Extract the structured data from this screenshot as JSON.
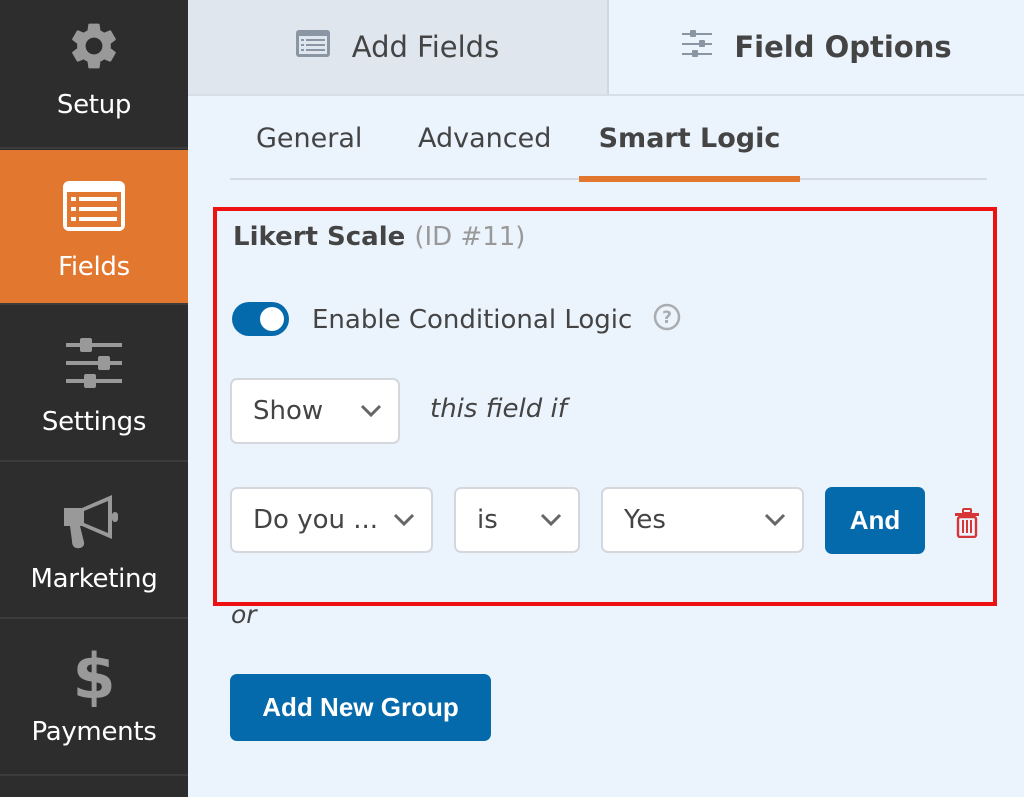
{
  "sidebar": {
    "items": [
      {
        "label": "Setup",
        "icon": "gear-icon",
        "active": false
      },
      {
        "label": "Fields",
        "icon": "form-list-icon",
        "active": true
      },
      {
        "label": "Settings",
        "icon": "sliders-icon",
        "active": false
      },
      {
        "label": "Marketing",
        "icon": "megaphone-icon",
        "active": false
      },
      {
        "label": "Payments",
        "icon": "dollar-icon",
        "active": false
      }
    ]
  },
  "top_tabs": {
    "add_fields": {
      "label": "Add Fields",
      "icon": "form-list-icon"
    },
    "field_options": {
      "label": "Field Options",
      "icon": "sliders-icon",
      "active": true
    }
  },
  "sub_tabs": [
    {
      "label": "General"
    },
    {
      "label": "Advanced"
    },
    {
      "label": "Smart Logic",
      "active": true
    }
  ],
  "field": {
    "name": "Likert Scale",
    "id_label": "(ID #11)"
  },
  "conditional_logic": {
    "toggle_label": "Enable Conditional Logic",
    "enabled": true,
    "help_icon": "question-circle-icon",
    "action_select": "Show",
    "action_suffix": "this field if",
    "rule": {
      "field_select": "Do you ...",
      "operator_select": "is",
      "value_select": "Yes",
      "and_button": "And",
      "delete_icon": "trash-icon"
    },
    "or_label": "or",
    "add_group_button": "Add New Group"
  },
  "colors": {
    "accent_orange": "#e27730",
    "primary_blue": "#056aab",
    "highlight_red": "#ee1111",
    "sidebar_bg": "#2d2d2d",
    "panel_bg": "#ebf3fc",
    "delete_red": "#d63638"
  }
}
